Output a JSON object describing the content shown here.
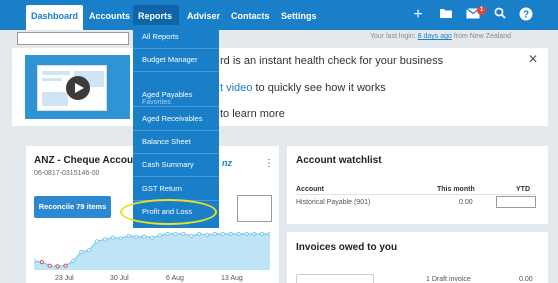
{
  "nav": {
    "dashboard": "Dashboard",
    "accounts": "Accounts",
    "reports": "Reports",
    "adviser": "Adviser",
    "contacts": "Contacts",
    "settings": "Settings",
    "notification_count": "1"
  },
  "header": {
    "last_login_prefix": "Your last login:",
    "last_login_link": "8 days ago",
    "last_login_suffix": "from New Zealand"
  },
  "banner": {
    "line1": "rd is an instant health check for your business",
    "line2_link": "t video",
    "line2_rest": "to quickly see how it works",
    "line3": "to learn more"
  },
  "reports_menu": {
    "all_reports": "All Reports",
    "budget_manager": "Budget Manager",
    "favorites_label": "Favorites",
    "items": [
      "Aged Payables",
      "Aged Receivables",
      "Balance Sheet",
      "Cash Summary",
      "GST Return",
      "Profit and Loss"
    ]
  },
  "bank_account": {
    "name": "ANZ - Cheque Account",
    "number": "06-0817-0315146-00",
    "reconcile_label": "Reconcile 79 items",
    "logo_text": "nz"
  },
  "watchlist": {
    "title": "Account watchlist",
    "columns": [
      "Account",
      "This month",
      "YTD"
    ],
    "rows": [
      {
        "account": "Historical Payable (901)",
        "this_month": "0.00"
      }
    ]
  },
  "invoices": {
    "title": "Invoices owed to you",
    "draft_text": "1 Draft invoice",
    "draft_amount": "0.00"
  },
  "chart_data": {
    "type": "area",
    "x_tick_labels": [
      "23 Jul",
      "30 Jul",
      "6 Aug",
      "13 Aug"
    ],
    "series_color": "#7ec8ef",
    "low_marker_color": "#e04848",
    "values": [
      0.25,
      0.22,
      0.12,
      0.1,
      0.12,
      0.25,
      0.5,
      0.55,
      0.8,
      0.85,
      0.9,
      0.88,
      0.95,
      0.92,
      0.93,
      0.9,
      0.96,
      1.0,
      1.0,
      1.0,
      0.95,
      1.0,
      0.98,
      1.0,
      1.0,
      1.0,
      1.0,
      1.0,
      1.0,
      1.0,
      1.0
    ],
    "low_indices": [
      1,
      2,
      3,
      4
    ]
  },
  "colors": {
    "brand_blue": "#1a7fc9",
    "highlight_yellow": "#e8e020"
  }
}
